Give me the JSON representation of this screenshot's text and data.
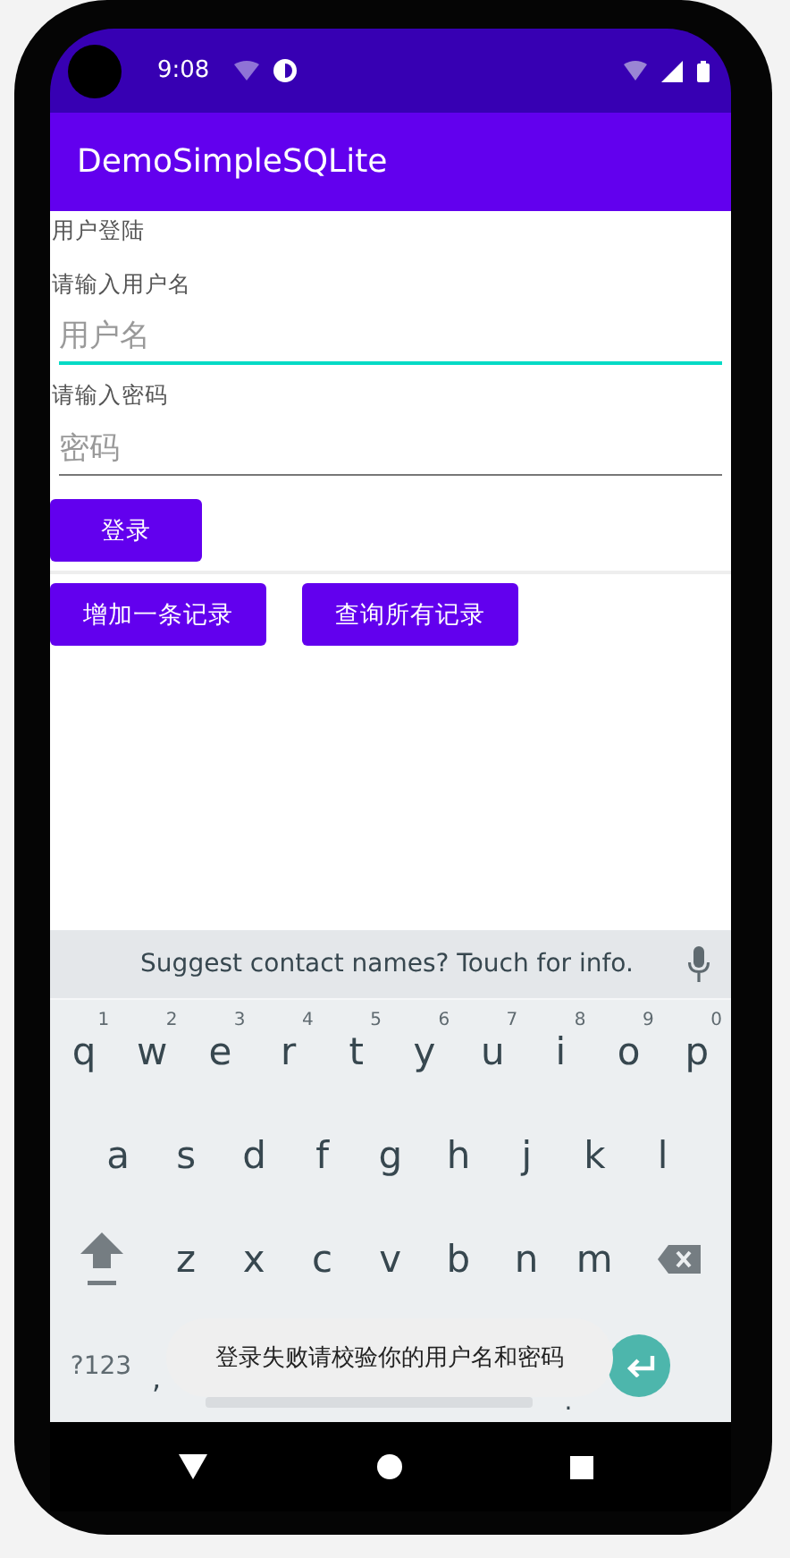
{
  "status_bar": {
    "time": "9:08"
  },
  "app_bar": {
    "title": "DemoSimpleSQLite"
  },
  "content": {
    "section_title": "用户登陆",
    "username_label": "请输入用户名",
    "username_field": {
      "placeholder": "用户名",
      "focused": true
    },
    "password_label": "请输入密码",
    "password_field": {
      "placeholder": "密码",
      "focused": false
    },
    "login_button": "登录",
    "buttons": [
      "增加一条记录",
      "查询所有记录"
    ]
  },
  "keyboard": {
    "suggestion": "Suggest contact names? Touch for info.",
    "rows": [
      [
        {
          "key": "q",
          "hint": "1"
        },
        {
          "key": "w",
          "hint": "2"
        },
        {
          "key": "e",
          "hint": "3"
        },
        {
          "key": "r",
          "hint": "4"
        },
        {
          "key": "t",
          "hint": "5"
        },
        {
          "key": "y",
          "hint": "6"
        },
        {
          "key": "u",
          "hint": "7"
        },
        {
          "key": "i",
          "hint": "8"
        },
        {
          "key": "o",
          "hint": "9"
        },
        {
          "key": "p",
          "hint": "0"
        }
      ],
      [
        {
          "key": "a"
        },
        {
          "key": "s"
        },
        {
          "key": "d"
        },
        {
          "key": "f"
        },
        {
          "key": "g"
        },
        {
          "key": "h"
        },
        {
          "key": "j"
        },
        {
          "key": "k"
        },
        {
          "key": "l"
        }
      ],
      [
        {
          "key": "z"
        },
        {
          "key": "x"
        },
        {
          "key": "c"
        },
        {
          "key": "v"
        },
        {
          "key": "b"
        },
        {
          "key": "n"
        },
        {
          "key": "m"
        }
      ]
    ],
    "symbols_key": "?123",
    "comma_key": ",",
    "period_key": "."
  },
  "toast": "登录失败请校验你的用户名和密码"
}
